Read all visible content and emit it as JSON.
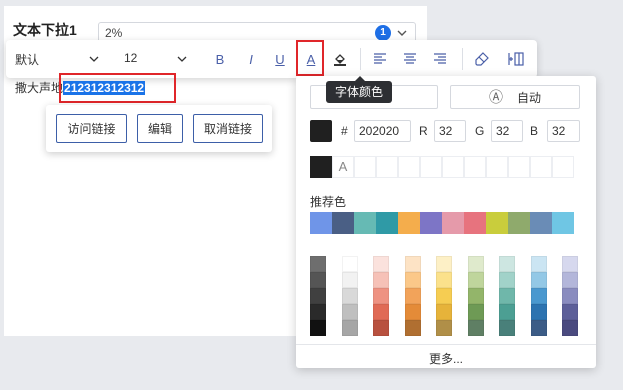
{
  "form": {
    "label": "文本下拉1",
    "value": "2%",
    "badge": "1"
  },
  "toolbar": {
    "font_family": "默认",
    "font_size": "12",
    "bold": "B",
    "italic": "I",
    "underline": "U",
    "font_color": "A"
  },
  "content": {
    "prefix": "撒大声地",
    "selected": "212312312312"
  },
  "link_popup": {
    "visit": "访问链接",
    "edit": "编辑",
    "unlink": "取消链接"
  },
  "tooltip": "字体颜色",
  "color_panel": {
    "auto_label": "自动",
    "auto_icon": "Ⓐ",
    "hash": "#",
    "hex": "202020",
    "r_label": "R",
    "r": "32",
    "g_label": "G",
    "g": "32",
    "b_label": "B",
    "b": "32",
    "recent_icon": "A",
    "current_color": "#202020",
    "recommended_title": "推荐色",
    "recommended": [
      "#6f95e8",
      "#4a5f85",
      "#66bab4",
      "#2f9aa6",
      "#f4ad4c",
      "#7d75c6",
      "#e59aaa",
      "#e7737e",
      "#c9cd3c",
      "#8faa6c",
      "#6a8cb6",
      "#6fc6e4"
    ],
    "palette": [
      [
        "#6e6e6e",
        "#555555",
        "#404040",
        "#2a2a2a",
        "#111111"
      ],
      [
        "#ffffff",
        "#f2f2f2",
        "#d9d9d9",
        "#bfbfbf",
        "#a6a6a6"
      ],
      [
        "#fbe2dd",
        "#f6c1b7",
        "#ee9282",
        "#e06a55",
        "#b8513f"
      ],
      [
        "#fde3c5",
        "#fbc889",
        "#f2a35a",
        "#e48b38",
        "#b06f31"
      ],
      [
        "#fdf0c6",
        "#fbe18b",
        "#f6cd52",
        "#e6b33a",
        "#b08f48"
      ],
      [
        "#dfeacc",
        "#bfd59c",
        "#93b56a",
        "#6e9a55",
        "#5f7f64"
      ],
      [
        "#cde6e1",
        "#a1d2c9",
        "#6fb7aa",
        "#4c9f93",
        "#49807a"
      ],
      [
        "#cbe5f3",
        "#93c8e6",
        "#4a98cf",
        "#2c73b0",
        "#3c5c86"
      ],
      [
        "#d6d8ee",
        "#b3b6da",
        "#8a8cbf",
        "#5d5f99",
        "#4a4a7f"
      ]
    ],
    "more": "更多..."
  }
}
